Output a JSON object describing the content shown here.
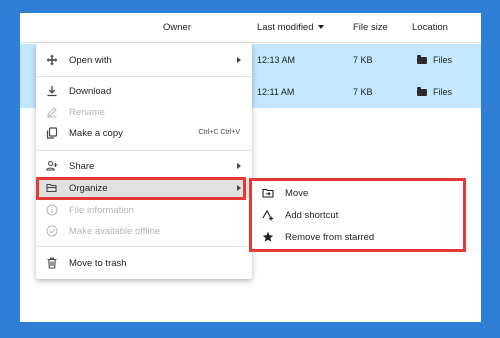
{
  "header": {
    "owner": "Owner",
    "last_modified": "Last modified",
    "file_size": "File size",
    "location": "Location"
  },
  "rows": [
    {
      "modified": "12:13 AM",
      "size": "7 KB",
      "location": "Files"
    },
    {
      "modified": "12:11 AM",
      "size": "7 KB",
      "location": "Files"
    }
  ],
  "context_menu": {
    "open_with": "Open with",
    "download": "Download",
    "rename": "Rename",
    "make_copy": "Make a copy",
    "make_copy_shortcut": "Ctrl+C Ctrl+V",
    "share": "Share",
    "organize": "Organize",
    "file_information": "File information",
    "make_offline": "Make available offline",
    "move_to_trash": "Move to trash"
  },
  "organize_submenu": {
    "move": "Move",
    "add_shortcut": "Add shortcut",
    "remove_starred": "Remove from starred"
  },
  "colors": {
    "background": "#2f7fd6",
    "selected_row": "#c2e7ff",
    "highlight_box": "#e53935"
  },
  "icons": {
    "open_with": "move-arrows-icon",
    "download": "download-icon",
    "rename": "pencil-icon",
    "make_copy": "copy-icon",
    "share": "person-add-icon",
    "organize": "folder-open-icon",
    "file_information": "info-icon",
    "make_offline": "offline-icon",
    "move_to_trash": "trash-icon",
    "move": "folder-move-icon",
    "add_shortcut": "add-shortcut-icon",
    "remove_starred": "star-icon"
  }
}
